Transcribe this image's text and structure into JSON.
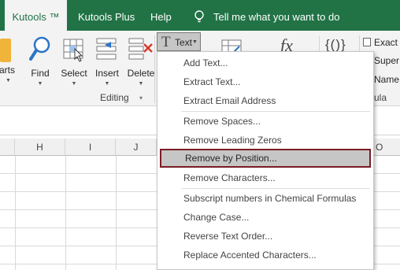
{
  "tabs": {
    "kutools": "Kutools ™",
    "kutools_plus": "Kutools Plus",
    "help": "Help",
    "tell_me": "Tell me what you want to do"
  },
  "ribbon": {
    "partial_left": "arts",
    "find": "Find",
    "select": "Select",
    "insert": "Insert",
    "delete": "Delete",
    "text": "Text",
    "group_editing": "Editing",
    "group_formula_partial": "ula",
    "small_items": [
      "Exact",
      "Super",
      "Name"
    ]
  },
  "columns": [
    "H",
    "I",
    "J",
    "O"
  ],
  "menu": {
    "items": [
      "Add Text...",
      "Extract Text...",
      "Extract Email Address",
      "Remove Spaces...",
      "Remove Leading Zeros",
      "Remove by Position...",
      "Remove Characters...",
      "Subscript numbers in Chemical Formulas",
      "Change Case...",
      "Reverse Text Order...",
      "Replace Accented Characters..."
    ],
    "highlighted": "Remove by Position..."
  },
  "colors": {
    "tab_green": "#217346",
    "highlight_border": "#7b1c25",
    "highlight_fill": "#c6c6c6"
  }
}
